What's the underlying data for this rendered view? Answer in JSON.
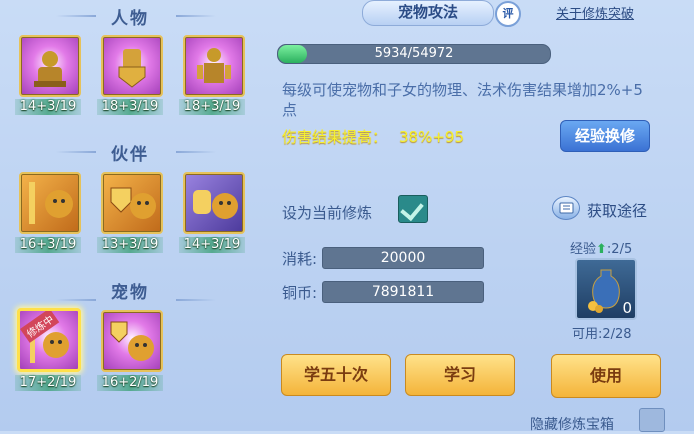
{
  "sections": {
    "people": {
      "title": "人物"
    },
    "partner": {
      "title": "伙伴"
    },
    "pet": {
      "title": "宠物"
    }
  },
  "skills": {
    "people": [
      "14+3/19",
      "18+3/19",
      "18+3/19"
    ],
    "partner": [
      "16+3/19",
      "13+3/19",
      "14+3/19"
    ],
    "pet": [
      "17+2/19",
      "16+2/19"
    ]
  },
  "pet_selected_tag": "修炼中",
  "header": {
    "title": "宠物攻法",
    "eval": "评",
    "link": "关于修炼突破"
  },
  "progress": {
    "text": "5934/54972",
    "fraction": 0.108
  },
  "description": "每级可使宠物和子女的物理、法术伤害结果增加2%+5点",
  "damage": {
    "label": "伤害结果提高：",
    "value": "38%+95"
  },
  "buttons": {
    "exchange": "经验换修",
    "learn50": "学五十次",
    "learn": "学习",
    "use": "使用"
  },
  "current": {
    "label": "设为当前修炼",
    "checked": true
  },
  "get_route": "获取途径",
  "cost": {
    "label": "消耗:",
    "value": "20000"
  },
  "copper": {
    "label": "铜币:",
    "value": "7891811"
  },
  "exp_item": {
    "label": "经验",
    "count_text": ":2/5",
    "qty": "0",
    "usable": "可用:2/28"
  },
  "hidden_box": "隐藏修炼宝箱",
  "colors": {
    "accent": "#3b72d4",
    "highlight": "#f6f030",
    "button_yellow": "#f4b43a"
  }
}
